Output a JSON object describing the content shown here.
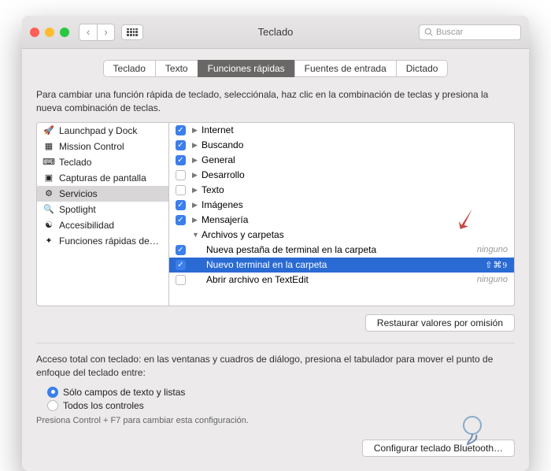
{
  "window": {
    "title": "Teclado"
  },
  "search": {
    "placeholder": "Buscar"
  },
  "tabs": [
    {
      "label": "Teclado",
      "active": false
    },
    {
      "label": "Texto",
      "active": false
    },
    {
      "label": "Funciones rápidas",
      "active": true
    },
    {
      "label": "Fuentes de entrada",
      "active": false
    },
    {
      "label": "Dictado",
      "active": false
    }
  ],
  "intro": "Para cambiar una función rápida de teclado, selecciónala, haz clic en la combinación de teclas y presiona la nueva combinación de teclas.",
  "sidebar": [
    {
      "icon": "launchpad",
      "label": "Launchpad y Dock"
    },
    {
      "icon": "mission",
      "label": "Mission Control"
    },
    {
      "icon": "keyboard",
      "label": "Teclado"
    },
    {
      "icon": "screenshot",
      "label": "Capturas de pantalla"
    },
    {
      "icon": "gear",
      "label": "Servicios",
      "selected": true
    },
    {
      "icon": "spotlight",
      "label": "Spotlight"
    },
    {
      "icon": "access",
      "label": "Accesibilidad"
    },
    {
      "icon": "apps",
      "label": "Funciones rápidas de…"
    }
  ],
  "shortcuts": [
    {
      "checked": true,
      "expand": "closed",
      "label": "Internet"
    },
    {
      "checked": true,
      "expand": "closed",
      "label": "Buscando"
    },
    {
      "checked": true,
      "expand": "closed",
      "label": "General"
    },
    {
      "checked": false,
      "expand": "closed",
      "label": "Desarrollo"
    },
    {
      "checked": false,
      "expand": "closed",
      "label": "Texto"
    },
    {
      "checked": true,
      "expand": "closed",
      "label": "Imágenes"
    },
    {
      "checked": true,
      "expand": "closed",
      "label": "Mensajería"
    },
    {
      "checked": null,
      "expand": "open",
      "label": "Archivos y carpetas"
    },
    {
      "checked": true,
      "indent": 1,
      "label": "Nueva pestaña de terminal en la carpeta",
      "shortcut": "ninguno"
    },
    {
      "checked": true,
      "indent": 1,
      "label": "Nuevo terminal en la carpeta",
      "shortcut": "⇧⌘9",
      "selected": true
    },
    {
      "checked": false,
      "indent": 1,
      "label": "Abrir archivo en TextEdit",
      "shortcut": "ninguno"
    }
  ],
  "restore_label": "Restaurar valores por omisión",
  "access_intro": "Acceso total con teclado: en las ventanas y cuadros de diálogo, presiona el tabulador para mover el punto de enfoque del teclado entre:",
  "radios": [
    {
      "label": "Sólo campos de texto y listas",
      "on": true
    },
    {
      "label": "Todos los controles",
      "on": false
    }
  ],
  "hint": "Presiona Control + F7 para cambiar esta configuración.",
  "bluetooth_label": "Configurar teclado Bluetooth…"
}
